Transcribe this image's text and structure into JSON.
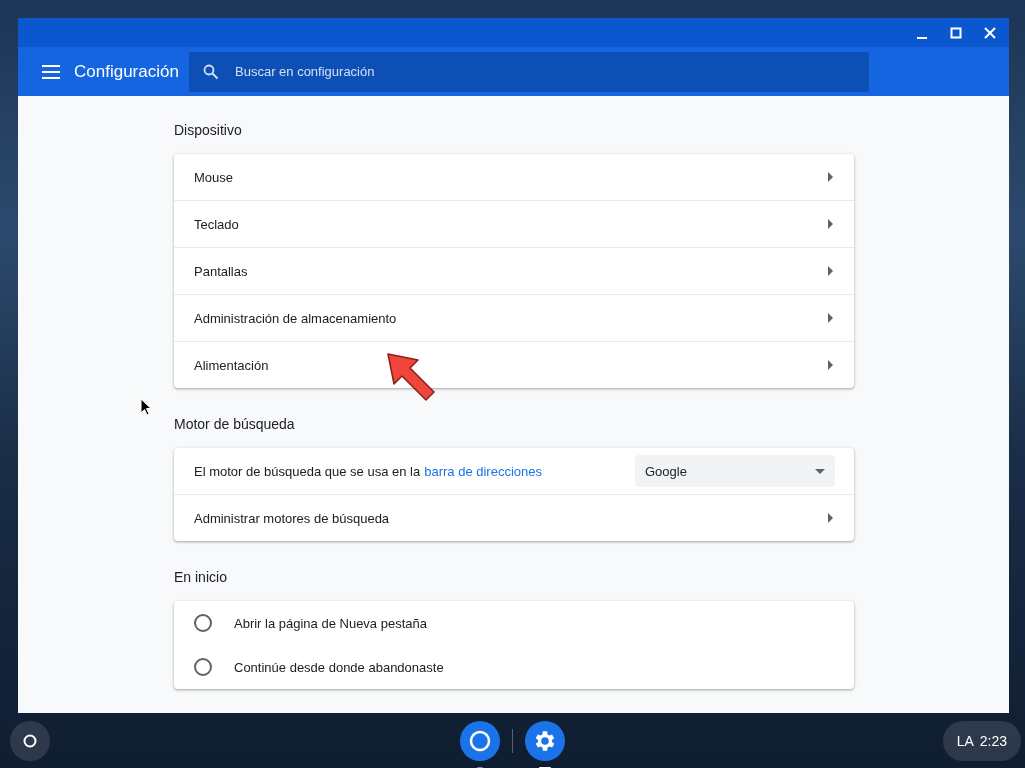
{
  "window": {
    "title": "Configuración",
    "search": {
      "placeholder": "Buscar en configuración"
    }
  },
  "sections": [
    {
      "title": "Dispositivo",
      "rows": [
        {
          "kind": "link",
          "label": "Mouse"
        },
        {
          "kind": "link",
          "label": "Teclado"
        },
        {
          "kind": "link",
          "label": "Pantallas"
        },
        {
          "kind": "link",
          "label": "Administración de almacenamiento"
        },
        {
          "kind": "link",
          "label": "Alimentación"
        }
      ]
    },
    {
      "title": "Motor de búsqueda",
      "rows": [
        {
          "kind": "select",
          "label": "El motor de búsqueda que se usa en la",
          "link": "barra de direcciones",
          "value": "Google"
        },
        {
          "kind": "link",
          "label": "Administrar motores de búsqueda"
        }
      ]
    },
    {
      "title": "En inicio",
      "rows": [
        {
          "kind": "radio",
          "label": "Abrir la página de Nueva pestaña",
          "selected": false
        },
        {
          "kind": "radio",
          "label": "Continúe desde donde abandonaste",
          "selected": false
        }
      ]
    }
  ],
  "shelf": {
    "apps": [
      {
        "kind": "browser",
        "active": false
      },
      {
        "kind": "settings",
        "active": true
      }
    ],
    "tray": {
      "layout": "LA",
      "time": "2:23"
    }
  }
}
